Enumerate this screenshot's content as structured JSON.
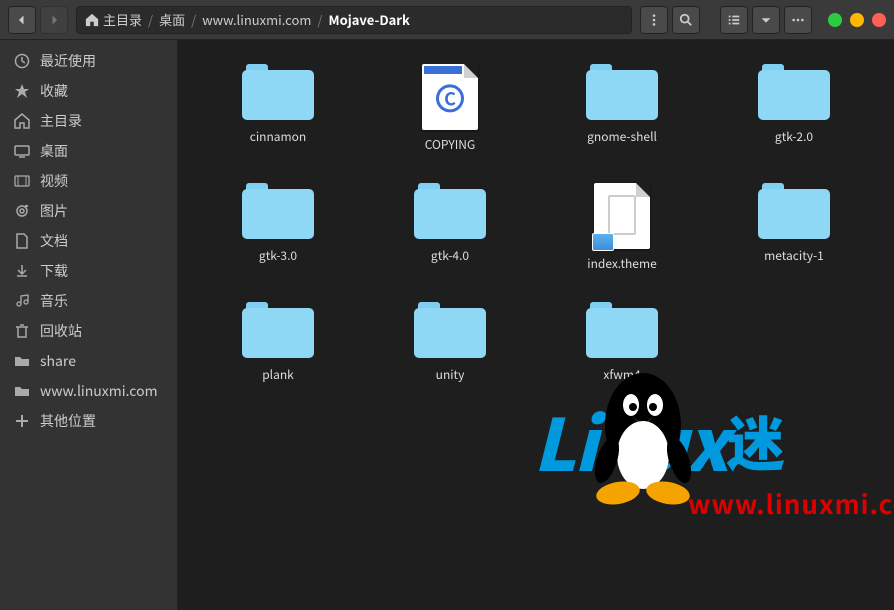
{
  "breadcrumb": {
    "items": [
      "主目录",
      "桌面",
      "www.linuxmi.com",
      "Mojave-Dark"
    ],
    "activeIndex": 3
  },
  "sidebar": {
    "items": [
      {
        "icon": "clock",
        "label": "最近使用"
      },
      {
        "icon": "star",
        "label": "收藏"
      },
      {
        "icon": "home",
        "label": "主目录"
      },
      {
        "icon": "desktop",
        "label": "桌面"
      },
      {
        "icon": "video",
        "label": "视频"
      },
      {
        "icon": "picture",
        "label": "图片"
      },
      {
        "icon": "document",
        "label": "文档"
      },
      {
        "icon": "download",
        "label": "下载"
      },
      {
        "icon": "music",
        "label": "音乐"
      },
      {
        "icon": "trash",
        "label": "回收站"
      },
      {
        "icon": "folder",
        "label": "share"
      },
      {
        "icon": "folder",
        "label": "www.linuxmi.com"
      },
      {
        "icon": "plus",
        "label": "其他位置"
      }
    ]
  },
  "files": [
    {
      "type": "folder",
      "name": "cinnamon"
    },
    {
      "type": "copying",
      "name": "COPYING"
    },
    {
      "type": "folder",
      "name": "gnome-shell"
    },
    {
      "type": "folder",
      "name": "gtk-2.0"
    },
    {
      "type": "folder",
      "name": "gtk-3.0"
    },
    {
      "type": "folder",
      "name": "gtk-4.0"
    },
    {
      "type": "theme",
      "name": "index.theme"
    },
    {
      "type": "folder",
      "name": "metacity-1"
    },
    {
      "type": "folder",
      "name": "plank"
    },
    {
      "type": "folder",
      "name": "unity"
    },
    {
      "type": "folder",
      "name": "xfwm4"
    }
  ],
  "watermark": {
    "brand": "Linux",
    "suffix": "迷",
    "url": "www.linuxmi.com"
  }
}
